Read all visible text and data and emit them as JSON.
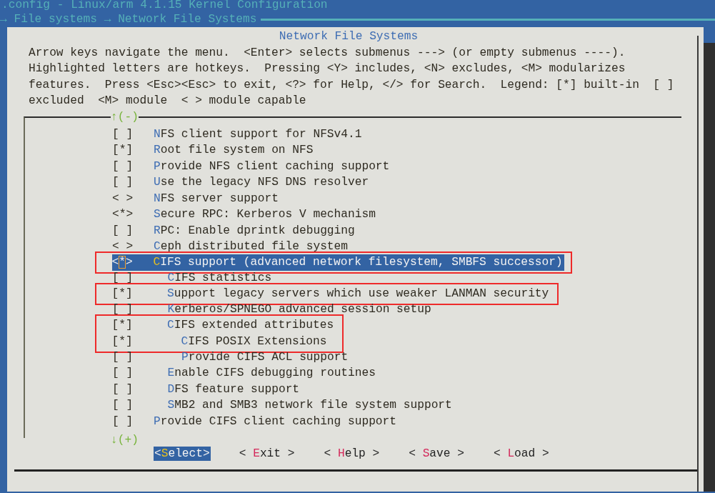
{
  "window": {
    "title": ".config - Linux/arm 4.1.15 Kernel Configuration",
    "breadcrumb": "→ File systems → Network File Systems"
  },
  "dialog": {
    "title": "Network File Systems",
    "help_lines": [
      "Arrow keys navigate the menu.  <Enter> selects submenus ---> (or empty submenus ----).",
      "Highlighted letters are hotkeys.  Pressing <Y> includes, <N> excludes, <M> modularizes",
      "features.  Press <Esc><Esc> to exit, <?> for Help, </> for Search.  Legend: [*] built-in  [ ]",
      "excluded  <M> module  < > module capable"
    ],
    "scroll_up": "↑(-)",
    "scroll_down": "↓(+)",
    "items": [
      {
        "mark": "[ ]",
        "hotkey": "N",
        "rest": "FS client support for NFSv4.1",
        "selected": false,
        "boxed": false
      },
      {
        "mark": "[*]",
        "hotkey": "R",
        "rest": "oot file system on NFS",
        "selected": false,
        "boxed": false
      },
      {
        "mark": "[ ]",
        "hotkey": "P",
        "rest": "rovide NFS client caching support",
        "selected": false,
        "boxed": false
      },
      {
        "mark": "[ ]",
        "hotkey": "U",
        "rest": "se the legacy NFS DNS resolver",
        "selected": false,
        "boxed": false
      },
      {
        "mark": "< >",
        "hotkey": "N",
        "rest": "FS server support",
        "selected": false,
        "boxed": false
      },
      {
        "mark": "<*>",
        "hotkey": "S",
        "rest": "ecure RPC: Kerberos V mechanism",
        "selected": false,
        "boxed": false
      },
      {
        "mark": "[ ]",
        "hotkey": "R",
        "rest": "PC: Enable dprintk debugging",
        "selected": false,
        "boxed": false
      },
      {
        "mark": "< >",
        "hotkey": "C",
        "rest": "eph distributed file system",
        "selected": false,
        "boxed": false
      },
      {
        "mark": "<*>",
        "hotkey": "C",
        "rest": "IFS support (advanced network filesystem, SMBFS successor)",
        "selected": true,
        "boxed": true,
        "children": [
          {
            "mark": "[ ]",
            "hotkey": "C",
            "rest": "IFS statistics",
            "selected": false,
            "boxed": false
          },
          {
            "mark": "[*]",
            "hotkey": "S",
            "rest": "upport legacy servers which use weaker LANMAN security",
            "selected": false,
            "boxed": true
          },
          {
            "mark": "[ ]",
            "hotkey": "K",
            "rest": "erberos/SPNEGO advanced session setup",
            "selected": false,
            "boxed": false
          },
          {
            "mark": "[*]",
            "hotkey": "C",
            "rest": "IFS extended attributes",
            "selected": false,
            "boxed": true,
            "children": [
              {
                "mark": "[*]",
                "hotkey": "C",
                "rest": "IFS POSIX Extensions",
                "selected": false,
                "boxed": true
              },
              {
                "mark": "[ ]",
                "hotkey": "P",
                "rest": "rovide CIFS ACL support",
                "selected": false,
                "boxed": false
              }
            ]
          },
          {
            "mark": "[ ]",
            "hotkey": "E",
            "rest": "nable CIFS debugging routines",
            "selected": false,
            "boxed": false
          },
          {
            "mark": "[ ]",
            "hotkey": "D",
            "rest": "FS feature support",
            "selected": false,
            "boxed": false
          },
          {
            "mark": "[ ]",
            "hotkey": "S",
            "rest": "MB2 and SMB3 network file system support",
            "selected": false,
            "boxed": false
          }
        ]
      },
      {
        "mark": "[ ]",
        "hotkey": "P",
        "rest": "rovide CIFS client caching support",
        "selected": false,
        "boxed": false
      }
    ],
    "buttons": [
      {
        "prefix": "<",
        "hotkey": "S",
        "rest": "elect>",
        "selected": true
      },
      {
        "prefix": "< ",
        "hotkey": "E",
        "rest": "xit >",
        "selected": false
      },
      {
        "prefix": "< ",
        "hotkey": "H",
        "rest": "elp >",
        "selected": false
      },
      {
        "prefix": "< ",
        "hotkey": "S",
        "rest": "ave >",
        "selected": false
      },
      {
        "prefix": "< ",
        "hotkey": "L",
        "rest": "oad >",
        "selected": false
      }
    ]
  }
}
